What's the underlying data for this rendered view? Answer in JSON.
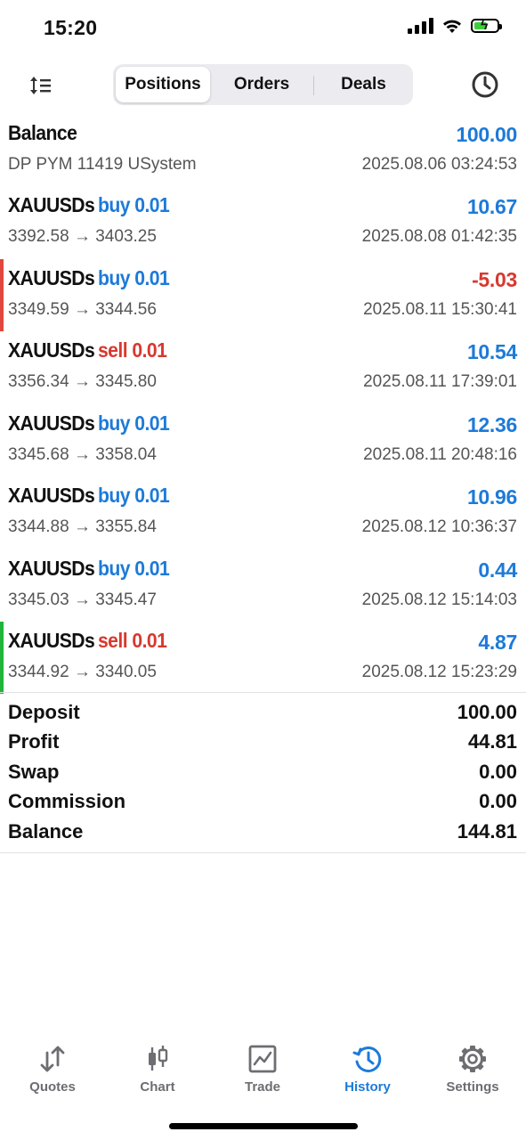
{
  "status_bar": {
    "time": "15:20"
  },
  "toolbar": {
    "tabs": [
      {
        "label": "Positions",
        "active": true
      },
      {
        "label": "Orders",
        "active": false
      },
      {
        "label": "Deals",
        "active": false
      }
    ]
  },
  "balance_entry": {
    "title": "Balance",
    "amount": "100.00",
    "comment": "DP PYM 11419 USystem",
    "time": "2025.08.06 03:24:53"
  },
  "positions": [
    {
      "symbol": "XAUUSDs",
      "side": "buy 0.01",
      "type": "buy",
      "prices": "3392.58 → 3403.25",
      "profit": "10.67",
      "profit_sign": "pos",
      "time": "2025.08.08 01:42:35",
      "marker": ""
    },
    {
      "symbol": "XAUUSDs",
      "side": "buy 0.01",
      "type": "buy",
      "prices": "3349.59 → 3344.56",
      "profit": "-5.03",
      "profit_sign": "neg",
      "time": "2025.08.11 15:30:41",
      "marker": "#e0483e"
    },
    {
      "symbol": "XAUUSDs",
      "side": "sell 0.01",
      "type": "sell",
      "prices": "3356.34 → 3345.80",
      "profit": "10.54",
      "profit_sign": "pos",
      "time": "2025.08.11 17:39:01",
      "marker": ""
    },
    {
      "symbol": "XAUUSDs",
      "side": "buy 0.01",
      "type": "buy",
      "prices": "3345.68 → 3358.04",
      "profit": "12.36",
      "profit_sign": "pos",
      "time": "2025.08.11 20:48:16",
      "marker": ""
    },
    {
      "symbol": "XAUUSDs",
      "side": "buy 0.01",
      "type": "buy",
      "prices": "3344.88 → 3355.84",
      "profit": "10.96",
      "profit_sign": "pos",
      "time": "2025.08.12 10:36:37",
      "marker": ""
    },
    {
      "symbol": "XAUUSDs",
      "side": "buy 0.01",
      "type": "buy",
      "prices": "3345.03 → 3345.47",
      "profit": "0.44",
      "profit_sign": "pos",
      "time": "2025.08.12 15:14:03",
      "marker": ""
    },
    {
      "symbol": "XAUUSDs",
      "side": "sell 0.01",
      "type": "sell",
      "prices": "3344.92 → 3340.05",
      "profit": "4.87",
      "profit_sign": "pos",
      "time": "2025.08.12 15:23:29",
      "marker": "#1fb53a"
    }
  ],
  "summary": [
    {
      "label": "Deposit",
      "value": "100.00"
    },
    {
      "label": "Profit",
      "value": "44.81"
    },
    {
      "label": "Swap",
      "value": "0.00"
    },
    {
      "label": "Commission",
      "value": "0.00"
    },
    {
      "label": "Balance",
      "value": "144.81"
    }
  ],
  "tabbar": [
    {
      "label": "Quotes",
      "icon": "quotes-icon",
      "active": false
    },
    {
      "label": "Chart",
      "icon": "chart-icon",
      "active": false
    },
    {
      "label": "Trade",
      "icon": "trade-icon",
      "active": false
    },
    {
      "label": "History",
      "icon": "history-icon",
      "active": true
    },
    {
      "label": "Settings",
      "icon": "settings-icon",
      "active": false
    }
  ],
  "colors": {
    "accent": "#1d7ad8",
    "negative": "#d7392f",
    "muted": "#6d6d72"
  }
}
